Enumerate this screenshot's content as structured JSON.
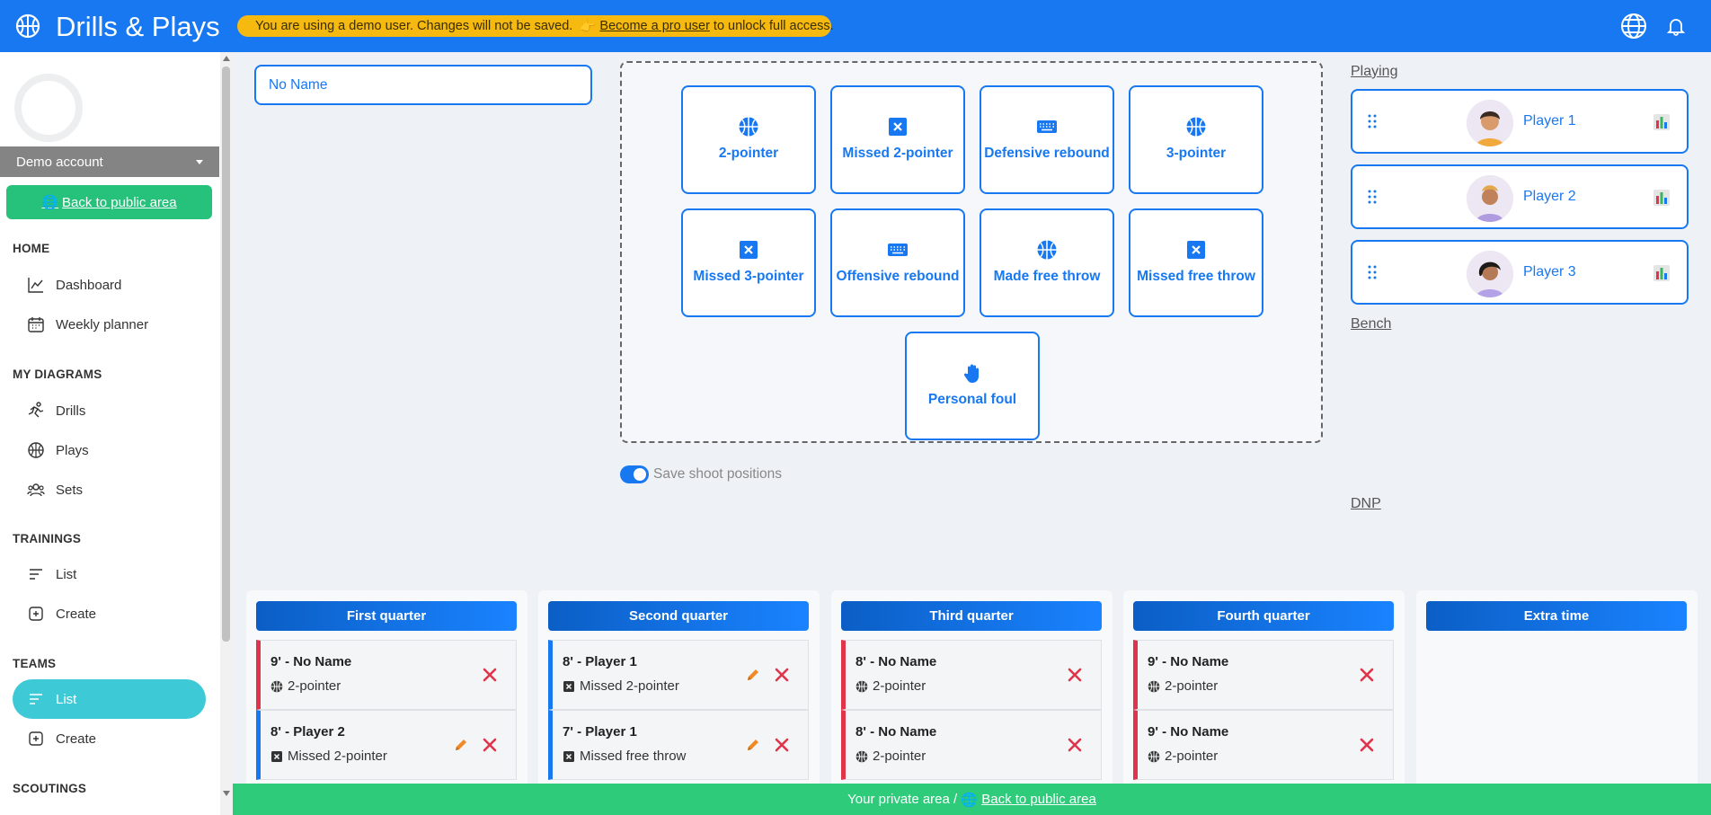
{
  "header": {
    "title": "Drills & Plays",
    "banner_text": "You are using a demo user. Changes will not be saved.",
    "banner_link": "Become a pro user",
    "banner_suffix": "to unlock full access."
  },
  "sidebar": {
    "account": "Demo account",
    "back_button": "Back to public area",
    "sections": {
      "home": "HOME",
      "my_diagrams": "MY DIAGRAMS",
      "trainings": "TRAININGS",
      "teams": "TEAMS",
      "scoutings": "SCOUTINGS"
    },
    "items": {
      "dashboard": "Dashboard",
      "weekly_planner": "Weekly planner",
      "drills": "Drills",
      "plays": "Plays",
      "sets": "Sets",
      "trainings_list": "List",
      "trainings_create": "Create",
      "teams_list": "List",
      "teams_create": "Create"
    }
  },
  "main": {
    "name_input_value": "No Name",
    "actions": {
      "two_pointer": "2-pointer",
      "missed_two": "Missed 2-pointer",
      "def_rebound": "Defensive rebound",
      "three_pointer": "3-pointer",
      "missed_three": "Missed 3-pointer",
      "off_rebound": "Offensive rebound",
      "made_ft": "Made free throw",
      "missed_ft": "Missed free throw",
      "foul": "Personal foul"
    },
    "toggle_label": "Save shoot positions"
  },
  "roster": {
    "playing_label": "Playing",
    "bench_label": "Bench",
    "dnp_label": "DNP",
    "players": [
      "Player 1",
      "Player 2",
      "Player 3"
    ]
  },
  "quarters": {
    "q1": {
      "title": "First quarter",
      "events": [
        {
          "time": "9' - No Name",
          "action": "2-pointer"
        },
        {
          "time": "8' - Player 2",
          "action": "Missed 2-pointer"
        }
      ]
    },
    "q2": {
      "title": "Second quarter",
      "events": [
        {
          "time": "8' - Player 1",
          "action": "Missed 2-pointer"
        },
        {
          "time": "7' - Player 1",
          "action": "Missed free throw"
        }
      ]
    },
    "q3": {
      "title": "Third quarter",
      "events": [
        {
          "time": "8' - No Name",
          "action": "2-pointer"
        },
        {
          "time": "8' - No Name",
          "action": "2-pointer"
        }
      ]
    },
    "q4": {
      "title": "Fourth quarter",
      "events": [
        {
          "time": "9' - No Name",
          "action": "2-pointer"
        },
        {
          "time": "9' - No Name",
          "action": "2-pointer"
        }
      ]
    },
    "ot": {
      "title": "Extra time",
      "events": []
    }
  },
  "footer": {
    "text": "Your private area / ",
    "link": "Back to public area"
  },
  "colors": {
    "primary": "#1778f2",
    "success": "#2ecc7a",
    "warning": "#f5b90f",
    "danger": "#e0344b",
    "active": "#3ec9d6"
  }
}
